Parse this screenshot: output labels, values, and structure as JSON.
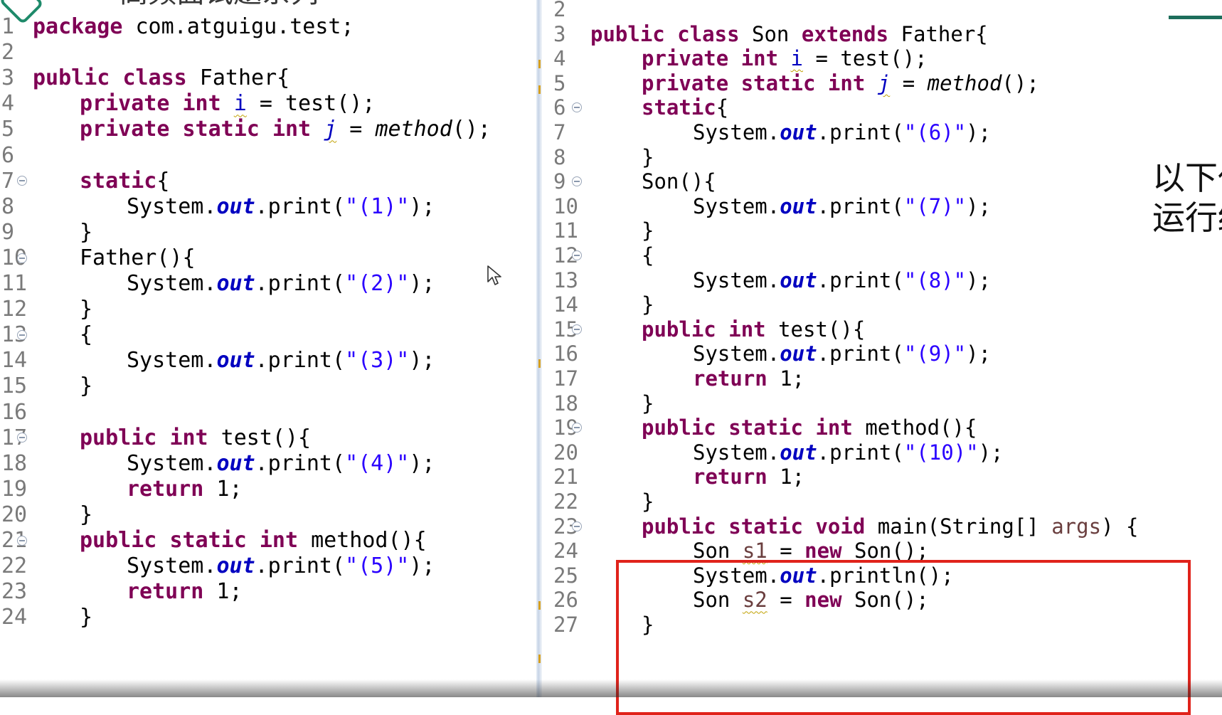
{
  "title_fragment": "高频面试题系列",
  "overlay_text": {
    "line1": "以下代",
    "line2": "运行结"
  },
  "left_file": {
    "first_line_number": 1,
    "lines": [
      {
        "n": "1",
        "tokens": [
          {
            "t": "package",
            "c": "kw"
          },
          {
            "t": " com.atguigu.test;"
          }
        ]
      },
      {
        "n": "2",
        "tokens": []
      },
      {
        "n": "3",
        "tokens": [
          {
            "t": "public",
            "c": "kw"
          },
          {
            "t": " "
          },
          {
            "t": "class",
            "c": "kw"
          },
          {
            "t": " Father{"
          }
        ]
      },
      {
        "n": "4",
        "indent": 2,
        "tokens": [
          {
            "t": "private",
            "c": "kw"
          },
          {
            "t": " "
          },
          {
            "t": "int",
            "c": "kw"
          },
          {
            "t": " "
          },
          {
            "t": "i",
            "c": "var-i squig"
          },
          {
            "t": " = test();"
          }
        ]
      },
      {
        "n": "5",
        "indent": 2,
        "tokens": [
          {
            "t": "private",
            "c": "kw"
          },
          {
            "t": " "
          },
          {
            "t": "static",
            "c": "kw"
          },
          {
            "t": " "
          },
          {
            "t": "int",
            "c": "kw"
          },
          {
            "t": " "
          },
          {
            "t": "j",
            "c": "var-i mit squig"
          },
          {
            "t": " = "
          },
          {
            "t": "method",
            "c": "mit"
          },
          {
            "t": "();"
          }
        ]
      },
      {
        "n": "6",
        "tokens": []
      },
      {
        "n": "7",
        "fold": true,
        "indent": 2,
        "tokens": [
          {
            "t": "static",
            "c": "kw"
          },
          {
            "t": "{"
          }
        ]
      },
      {
        "n": "8",
        "indent": 4,
        "tokens": [
          {
            "t": "System."
          },
          {
            "t": "out",
            "c": "fld"
          },
          {
            "t": ".print("
          },
          {
            "t": "\"(1)\"",
            "c": "str"
          },
          {
            "t": ");"
          }
        ]
      },
      {
        "n": "9",
        "indent": 2,
        "tokens": [
          {
            "t": "}"
          }
        ]
      },
      {
        "n": "10",
        "fold": true,
        "indent": 2,
        "tokens": [
          {
            "t": "Father(){"
          }
        ]
      },
      {
        "n": "11",
        "indent": 4,
        "tokens": [
          {
            "t": "System."
          },
          {
            "t": "out",
            "c": "fld"
          },
          {
            "t": ".print("
          },
          {
            "t": "\"(2)\"",
            "c": "str"
          },
          {
            "t": ");"
          }
        ]
      },
      {
        "n": "12",
        "indent": 2,
        "tokens": [
          {
            "t": "}"
          }
        ]
      },
      {
        "n": "13",
        "fold": true,
        "indent": 2,
        "tokens": [
          {
            "t": "{"
          }
        ]
      },
      {
        "n": "14",
        "indent": 4,
        "tokens": [
          {
            "t": "System."
          },
          {
            "t": "out",
            "c": "fld"
          },
          {
            "t": ".print("
          },
          {
            "t": "\"(3)\"",
            "c": "str"
          },
          {
            "t": ");"
          }
        ]
      },
      {
        "n": "15",
        "indent": 2,
        "tokens": [
          {
            "t": "}"
          }
        ]
      },
      {
        "n": "16",
        "tokens": []
      },
      {
        "n": "17",
        "fold": true,
        "indent": 2,
        "tokens": [
          {
            "t": "public",
            "c": "kw"
          },
          {
            "t": " "
          },
          {
            "t": "int",
            "c": "kw"
          },
          {
            "t": " test(){"
          }
        ]
      },
      {
        "n": "18",
        "indent": 4,
        "tokens": [
          {
            "t": "System."
          },
          {
            "t": "out",
            "c": "fld"
          },
          {
            "t": ".print("
          },
          {
            "t": "\"(4)\"",
            "c": "str"
          },
          {
            "t": ");"
          }
        ]
      },
      {
        "n": "19",
        "indent": 4,
        "tokens": [
          {
            "t": "return",
            "c": "kw"
          },
          {
            "t": " 1;"
          }
        ]
      },
      {
        "n": "20",
        "indent": 2,
        "tokens": [
          {
            "t": "}"
          }
        ]
      },
      {
        "n": "21",
        "fold": true,
        "indent": 2,
        "tokens": [
          {
            "t": "public",
            "c": "kw"
          },
          {
            "t": " "
          },
          {
            "t": "static",
            "c": "kw"
          },
          {
            "t": " "
          },
          {
            "t": "int",
            "c": "kw"
          },
          {
            "t": " method(){"
          }
        ]
      },
      {
        "n": "22",
        "indent": 4,
        "tokens": [
          {
            "t": "System."
          },
          {
            "t": "out",
            "c": "fld"
          },
          {
            "t": ".print("
          },
          {
            "t": "\"(5)\"",
            "c": "str"
          },
          {
            "t": ");"
          }
        ]
      },
      {
        "n": "23",
        "indent": 4,
        "tokens": [
          {
            "t": "return",
            "c": "kw"
          },
          {
            "t": " 1;"
          }
        ]
      },
      {
        "n": "24",
        "indent": 2,
        "tokens": [
          {
            "t": "}"
          }
        ]
      }
    ]
  },
  "right_file": {
    "lines": [
      {
        "n": "2",
        "tokens": []
      },
      {
        "n": "3",
        "tokens": [
          {
            "t": "public",
            "c": "kw"
          },
          {
            "t": " "
          },
          {
            "t": "class",
            "c": "kw"
          },
          {
            "t": " Son "
          },
          {
            "t": "extends",
            "c": "kw"
          },
          {
            "t": " Father{"
          }
        ]
      },
      {
        "n": "4",
        "indent": 2,
        "tokens": [
          {
            "t": "private",
            "c": "kw"
          },
          {
            "t": " "
          },
          {
            "t": "int",
            "c": "kw"
          },
          {
            "t": " "
          },
          {
            "t": "i",
            "c": "var-i squig"
          },
          {
            "t": " = test();"
          }
        ]
      },
      {
        "n": "5",
        "indent": 2,
        "tokens": [
          {
            "t": "private",
            "c": "kw"
          },
          {
            "t": " "
          },
          {
            "t": "static",
            "c": "kw"
          },
          {
            "t": " "
          },
          {
            "t": "int",
            "c": "kw"
          },
          {
            "t": " "
          },
          {
            "t": "j",
            "c": "var-i mit squig"
          },
          {
            "t": " = "
          },
          {
            "t": "method",
            "c": "mit"
          },
          {
            "t": "();"
          }
        ]
      },
      {
        "n": "6",
        "fold": true,
        "indent": 2,
        "tokens": [
          {
            "t": "static",
            "c": "kw"
          },
          {
            "t": "{"
          }
        ]
      },
      {
        "n": "7",
        "indent": 4,
        "tokens": [
          {
            "t": "System."
          },
          {
            "t": "out",
            "c": "fld"
          },
          {
            "t": ".print("
          },
          {
            "t": "\"(6)\"",
            "c": "str"
          },
          {
            "t": ");"
          }
        ]
      },
      {
        "n": "8",
        "indent": 2,
        "tokens": [
          {
            "t": "}"
          }
        ]
      },
      {
        "n": "9",
        "fold": true,
        "indent": 2,
        "tokens": [
          {
            "t": "Son(){"
          }
        ]
      },
      {
        "n": "10",
        "indent": 4,
        "tokens": [
          {
            "t": "System."
          },
          {
            "t": "out",
            "c": "fld"
          },
          {
            "t": ".print("
          },
          {
            "t": "\"(7)\"",
            "c": "str"
          },
          {
            "t": ");"
          }
        ]
      },
      {
        "n": "11",
        "indent": 2,
        "tokens": [
          {
            "t": "}"
          }
        ]
      },
      {
        "n": "12",
        "fold": true,
        "indent": 2,
        "tokens": [
          {
            "t": "{"
          }
        ]
      },
      {
        "n": "13",
        "indent": 4,
        "tokens": [
          {
            "t": "System."
          },
          {
            "t": "out",
            "c": "fld"
          },
          {
            "t": ".print("
          },
          {
            "t": "\"(8)\"",
            "c": "str"
          },
          {
            "t": ");"
          }
        ]
      },
      {
        "n": "14",
        "indent": 2,
        "tokens": [
          {
            "t": "}"
          }
        ]
      },
      {
        "n": "15",
        "fold": true,
        "indent": 2,
        "tokens": [
          {
            "t": "public",
            "c": "kw"
          },
          {
            "t": " "
          },
          {
            "t": "int",
            "c": "kw"
          },
          {
            "t": " test(){"
          }
        ]
      },
      {
        "n": "16",
        "indent": 4,
        "tokens": [
          {
            "t": "System."
          },
          {
            "t": "out",
            "c": "fld"
          },
          {
            "t": ".print("
          },
          {
            "t": "\"(9)\"",
            "c": "str"
          },
          {
            "t": ");"
          }
        ]
      },
      {
        "n": "17",
        "indent": 4,
        "tokens": [
          {
            "t": "return",
            "c": "kw"
          },
          {
            "t": " 1;"
          }
        ]
      },
      {
        "n": "18",
        "indent": 2,
        "tokens": [
          {
            "t": "}"
          }
        ]
      },
      {
        "n": "19",
        "fold": true,
        "indent": 2,
        "tokens": [
          {
            "t": "public",
            "c": "kw"
          },
          {
            "t": " "
          },
          {
            "t": "static",
            "c": "kw"
          },
          {
            "t": " "
          },
          {
            "t": "int",
            "c": "kw"
          },
          {
            "t": " method(){"
          }
        ]
      },
      {
        "n": "20",
        "indent": 4,
        "tokens": [
          {
            "t": "System."
          },
          {
            "t": "out",
            "c": "fld"
          },
          {
            "t": ".print("
          },
          {
            "t": "\"(10)\"",
            "c": "str"
          },
          {
            "t": ");"
          }
        ]
      },
      {
        "n": "21",
        "indent": 4,
        "tokens": [
          {
            "t": "return",
            "c": "kw"
          },
          {
            "t": " 1;"
          }
        ]
      },
      {
        "n": "22",
        "indent": 2,
        "tokens": [
          {
            "t": "}"
          }
        ]
      },
      {
        "n": "23",
        "fold": true,
        "indent": 2,
        "tokens": [
          {
            "t": "public",
            "c": "kw"
          },
          {
            "t": " "
          },
          {
            "t": "static",
            "c": "kw"
          },
          {
            "t": " "
          },
          {
            "t": "void",
            "c": "kw"
          },
          {
            "t": " main(String[] "
          },
          {
            "t": "args",
            "c": "param"
          },
          {
            "t": ") {"
          }
        ]
      },
      {
        "n": "24",
        "indent": 4,
        "tokens": [
          {
            "t": "Son "
          },
          {
            "t": "s1",
            "c": "param squig"
          },
          {
            "t": " = "
          },
          {
            "t": "new",
            "c": "kw"
          },
          {
            "t": " Son();"
          }
        ]
      },
      {
        "n": "25",
        "indent": 4,
        "tokens": [
          {
            "t": "System."
          },
          {
            "t": "out",
            "c": "fld"
          },
          {
            "t": ".println();"
          }
        ]
      },
      {
        "n": "26",
        "indent": 4,
        "tokens": [
          {
            "t": "Son "
          },
          {
            "t": "s2",
            "c": "param squig"
          },
          {
            "t": " = "
          },
          {
            "t": "new",
            "c": "kw"
          },
          {
            "t": " Son();"
          }
        ]
      },
      {
        "n": "27",
        "indent": 2,
        "tokens": [
          {
            "t": "}"
          }
        ]
      }
    ]
  },
  "colors": {
    "keyword": "#7f0055",
    "string": "#2a00ff",
    "field": "#0000c0",
    "highlight_box": "#e0231b"
  }
}
